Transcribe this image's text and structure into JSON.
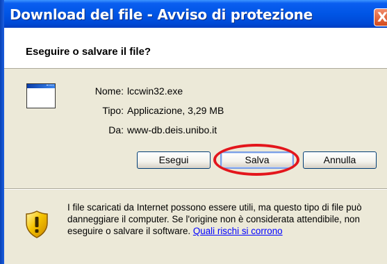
{
  "window": {
    "title": "Download del file - Avviso di protezione",
    "close_label": "X"
  },
  "header": {
    "title": "Eseguire o salvare il file?"
  },
  "file_info": {
    "icon": "application-window-icon",
    "name_label": "Nome:",
    "name_value": "lccwin32.exe",
    "type_label": "Tipo:",
    "type_value": "Applicazione, 3,29 MB",
    "from_label": "Da:",
    "from_value": "www-db.deis.unibo.it"
  },
  "buttons": {
    "run_label": "Esegui",
    "save_label": "Salva",
    "cancel_label": "Annulla"
  },
  "annotation": {
    "highlight_color": "#e3161c",
    "highlighted_button": "Salva"
  },
  "warning": {
    "icon": "security-shield-icon",
    "text": "I file scaricati da Internet possono essere utili, ma questo tipo di file può danneggiare il computer. Se l'origine non è considerata attendibile, non eseguire o salvare il software.",
    "link_text": "Quali rischi si corrono"
  },
  "colors": {
    "titlebar": "#0055e5",
    "dialog_bg": "#ece9d8",
    "link": "#0000ff"
  }
}
